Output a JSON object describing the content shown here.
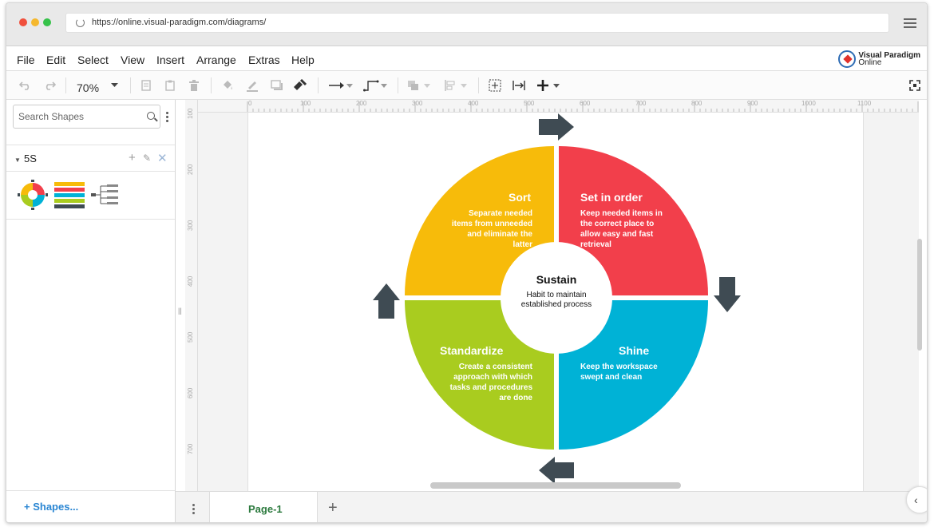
{
  "browser": {
    "url": "https://online.visual-paradigm.com/diagrams/"
  },
  "menu": {
    "items": [
      "File",
      "Edit",
      "Select",
      "View",
      "Insert",
      "Arrange",
      "Extras",
      "Help"
    ]
  },
  "logo": {
    "line1": "Visual Paradigm",
    "line2": "Online"
  },
  "toolbar": {
    "zoom": "70%"
  },
  "sidebar": {
    "search_placeholder": "Search Shapes",
    "section_label": "5S",
    "more_shapes": "+ Shapes..."
  },
  "ruler": {
    "h_labels": [
      "0",
      "100",
      "200",
      "300",
      "400",
      "500",
      "600",
      "700",
      "800",
      "900",
      "1000",
      "1100"
    ],
    "v_labels": [
      "100",
      "200",
      "300",
      "400",
      "500",
      "600",
      "700"
    ]
  },
  "diagram": {
    "center_title": "Sustain",
    "center_desc_line1": "Habit to maintain",
    "center_desc_line2": "established process",
    "sort": {
      "title": "Sort",
      "lines": [
        "Separate needed",
        "items from unneeded",
        "and eliminate the",
        "latter"
      ],
      "color": "#F7BB0A"
    },
    "set_in_order": {
      "title": "Set in order",
      "lines": [
        "Keep needed items in",
        "the correct place to",
        "allow easy and fast",
        "retrieval"
      ],
      "color": "#F23F4B"
    },
    "standardize": {
      "title": "Standardize",
      "lines": [
        "Create a consistent",
        "approach with which",
        "tasks and procedures",
        "are done"
      ],
      "color": "#A9CC1F"
    },
    "shine": {
      "title": "Shine",
      "lines": [
        "Keep the workspace",
        "swept and clean"
      ],
      "color": "#00B2D6"
    },
    "arrow_color": "#3F4B53"
  },
  "pages": {
    "current": "Page-1"
  }
}
